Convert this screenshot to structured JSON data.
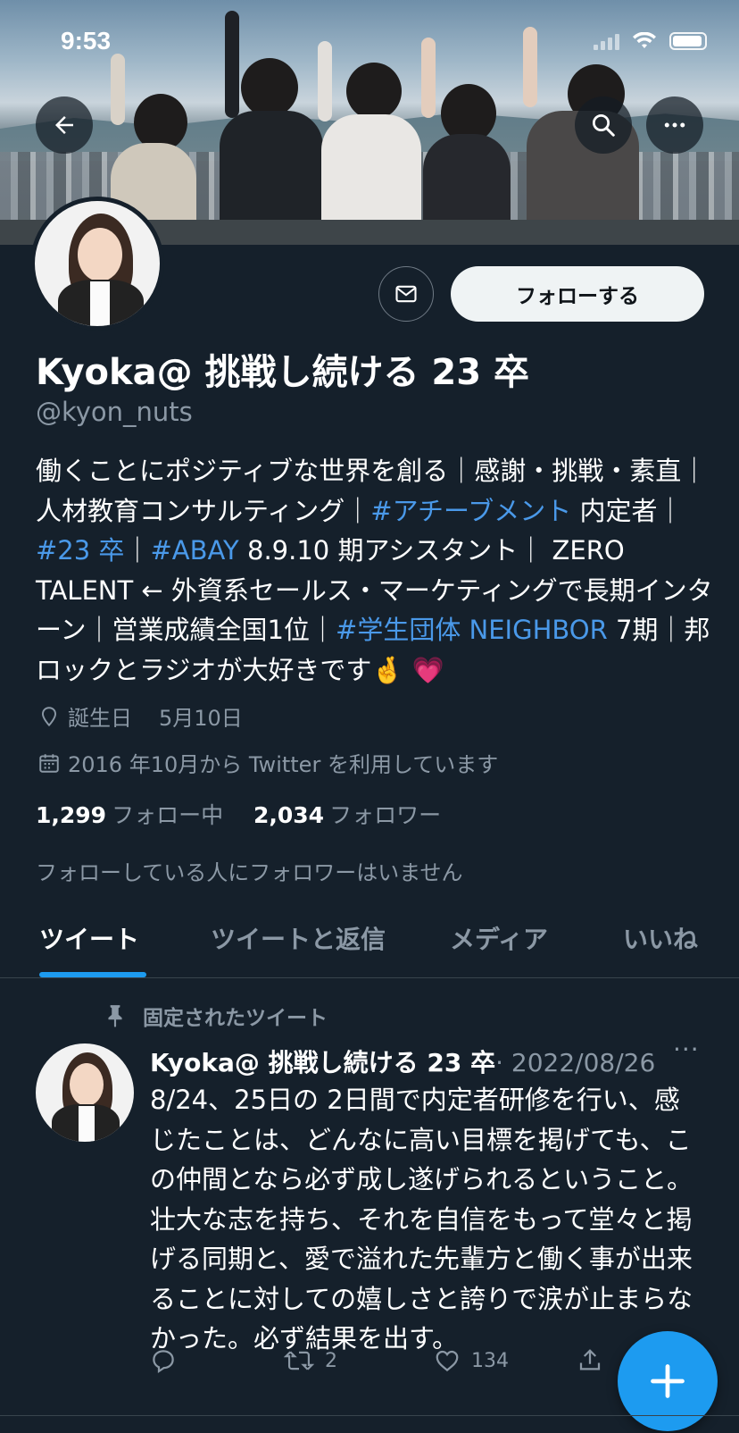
{
  "status_bar": {
    "time": "9:53"
  },
  "profile": {
    "display_name": "Kyoka@ 挑戦し続ける 23 卒",
    "handle": "@kyon_nuts",
    "follow_label": "フォローする",
    "bio": [
      {
        "text": "働くことにポジティブな世界を創る｜感謝・挑戦・素直｜人材教育コンサルティング｜",
        "tag": false
      },
      {
        "text": "#アチーブメント",
        "tag": true
      },
      {
        "text": " 内定者｜",
        "tag": false
      },
      {
        "text": "#23 卒",
        "tag": true
      },
      {
        "text": "｜",
        "tag": false
      },
      {
        "text": "#ABAY",
        "tag": true
      },
      {
        "text": " 8.9.10 期アシスタント｜ ZERO TALENT ← 外資系セールス・マーケティングで長期インターン｜営業成績全国1位｜",
        "tag": false
      },
      {
        "text": "#学生団体 NEIGHBOR",
        "tag": true
      },
      {
        "text": " 7期｜邦ロックとラジオが大好きです🤞 💗",
        "tag": false
      }
    ],
    "birthday_label": "誕生日",
    "birthday_value": "5月10日",
    "joined": "2016 年10月から Twitter を利用しています",
    "following_count": "1,299",
    "following_label": "フォロー中",
    "followers_count": "2,034",
    "followers_label": "フォロワー",
    "no_mutual": "フォローしている人にフォロワーはいません"
  },
  "tabs": [
    {
      "label": "ツイート",
      "active": true
    },
    {
      "label": "ツイートと返信",
      "active": false
    },
    {
      "label": "メディア",
      "active": false
    },
    {
      "label": "いいね",
      "active": false
    }
  ],
  "pinned_tweet": {
    "pinned_label": "固定されたツイート",
    "author": "Kyoka@ 挑戦し続ける 23 卒",
    "date": "· 2022/08/26",
    "more": "···",
    "text": "8/24、25日の 2日間で内定者研修を行い、感じたことは、どんなに高い目標を掲げても、この仲間となら必ず成し遂げられるということ。壮大な志を持ち、それを自信をもって堂々と掲げる同期と、愛で溢れた先輩方と働く事が出来ることに対しての嬉しさと誇りで涙が止まらなかった。必ず結果を出す。",
    "reply_count": "",
    "retweet_count": "2",
    "like_count": "134"
  },
  "icons": {
    "back": "back-arrow-icon",
    "search": "search-icon",
    "more": "more-icon",
    "mail": "mail-icon",
    "location": "location-pin-icon",
    "calendar": "calendar-icon",
    "pin": "pin-icon",
    "reply": "reply-icon",
    "retweet": "retweet-icon",
    "like": "heart-icon",
    "share": "share-icon",
    "compose": "compose-plus-icon"
  },
  "colors": {
    "background": "#15202b",
    "accent": "#1d9bf0",
    "hashtag": "#4a99e9",
    "secondary_text": "#8b98a5"
  }
}
